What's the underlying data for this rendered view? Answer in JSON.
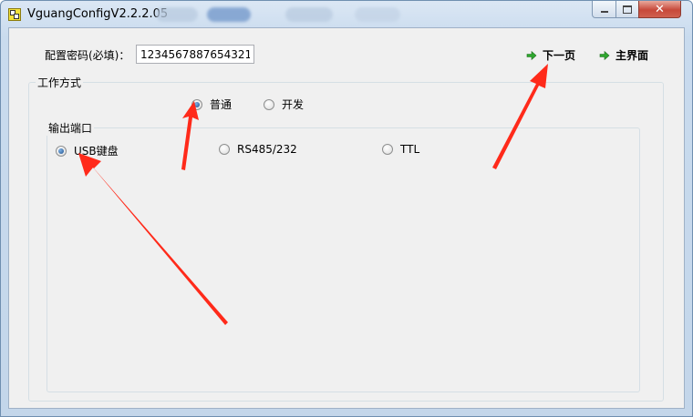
{
  "window": {
    "title": "VguangConfigV2.2.2.05",
    "caption_buttons": [
      "minimize",
      "maximize",
      "close"
    ]
  },
  "form": {
    "password_label": "配置密码(必填)：",
    "password_value": "1234567887654321"
  },
  "nav": {
    "next_page": "下一页",
    "main_screen": "主界面"
  },
  "work_mode": {
    "title": "工作方式",
    "options": [
      {
        "label": "普通",
        "selected": true
      },
      {
        "label": "开发",
        "selected": false
      }
    ]
  },
  "output_port": {
    "title": "输出端口",
    "options": [
      {
        "label": "USB键盘",
        "selected": true
      },
      {
        "label": "RS485/232",
        "selected": false
      },
      {
        "label": "TTL",
        "selected": false
      }
    ]
  },
  "colors": {
    "annotation_arrow": "#ff2a1a",
    "nav_arrow": "#2ea82e"
  }
}
